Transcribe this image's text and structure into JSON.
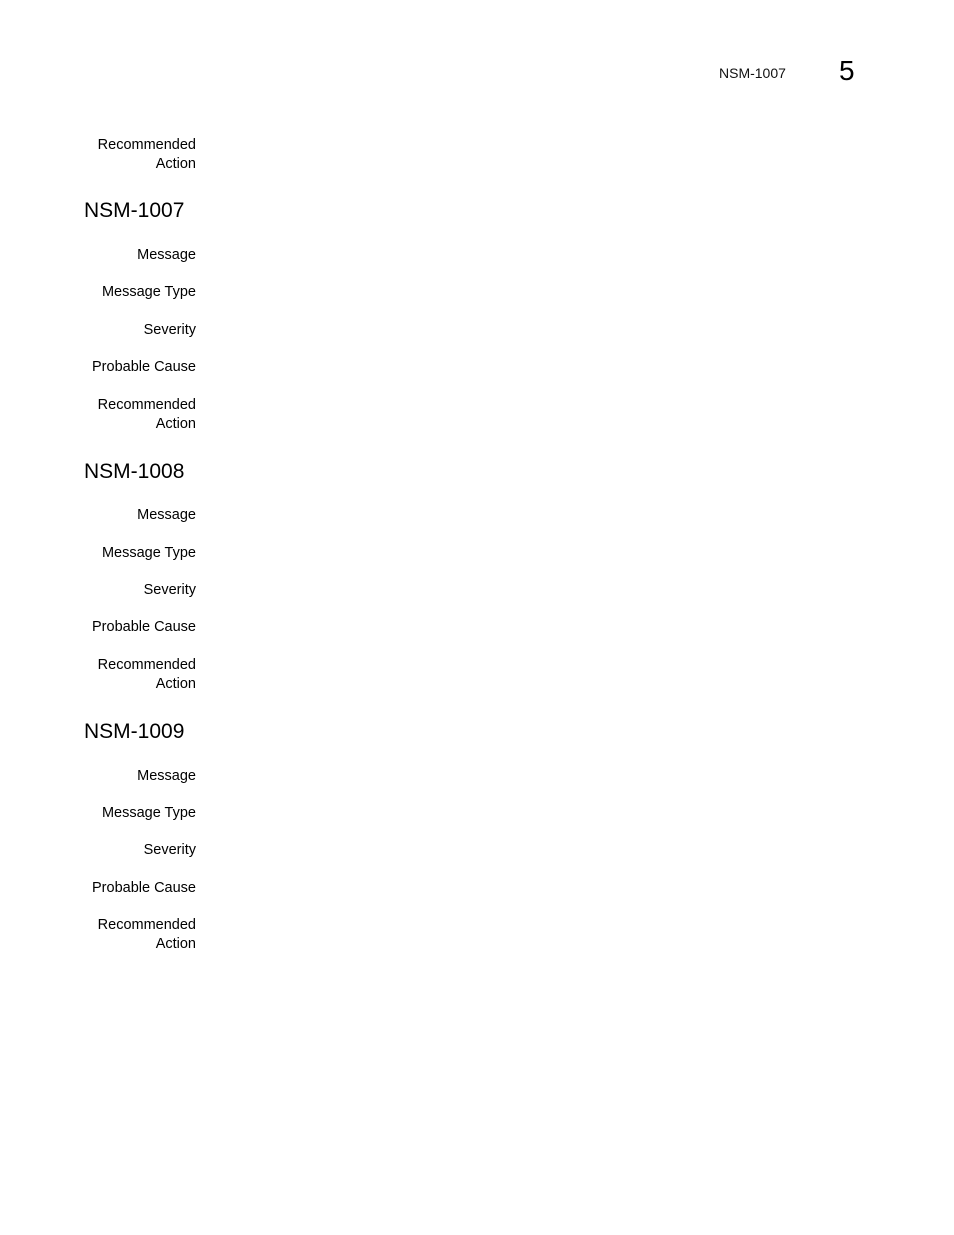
{
  "header": {
    "title": "NSM-1007",
    "chapter": "5"
  },
  "top_block": {
    "recommended_action_label": [
      "Recommended",
      "Action"
    ]
  },
  "sections": [
    {
      "id": "NSM-1007",
      "labels": {
        "message": "Message",
        "message_type": "Message Type",
        "severity": "Severity",
        "probable_cause": "Probable Cause",
        "recommended_action": [
          "Recommended",
          "Action"
        ]
      }
    },
    {
      "id": "NSM-1008",
      "labels": {
        "message": "Message",
        "message_type": "Message Type",
        "severity": "Severity",
        "probable_cause": "Probable Cause",
        "recommended_action": [
          "Recommended",
          "Action"
        ]
      }
    },
    {
      "id": "NSM-1009",
      "labels": {
        "message": "Message",
        "message_type": "Message Type",
        "severity": "Severity",
        "probable_cause": "Probable Cause",
        "recommended_action": [
          "Recommended",
          "Action"
        ]
      }
    }
  ]
}
